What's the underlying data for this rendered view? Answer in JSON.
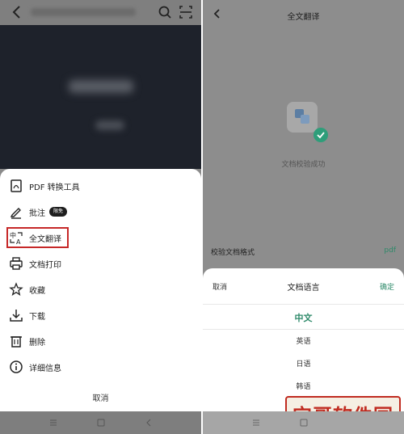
{
  "left": {
    "menu": [
      {
        "label": "PDF 转换工具",
        "icon": "pdf-icon"
      },
      {
        "label": "批注",
        "icon": "pen-icon",
        "badge": "限免"
      },
      {
        "label": "全文翻译",
        "icon": "translate-icon"
      },
      {
        "label": "文档打印",
        "icon": "printer-icon"
      },
      {
        "label": "收藏",
        "icon": "star-icon"
      },
      {
        "label": "下载",
        "icon": "download-icon"
      },
      {
        "label": "删除",
        "icon": "trash-icon"
      },
      {
        "label": "详细信息",
        "icon": "info-icon"
      }
    ],
    "cancel": "取消"
  },
  "right": {
    "title": "全文翻译",
    "status": "文档校验成功",
    "verify_label": "校验文档格式",
    "verify_value": "pdf",
    "sheet": {
      "cancel": "取消",
      "title": "文档语言",
      "confirm": "确定",
      "options": [
        "中文",
        "英语",
        "日语",
        "韩语"
      ]
    }
  },
  "watermark": "宝哥软件园",
  "colors": {
    "accent": "#2e8a6a",
    "highlight": "#c62828",
    "doc_bg": "#1e222b"
  }
}
